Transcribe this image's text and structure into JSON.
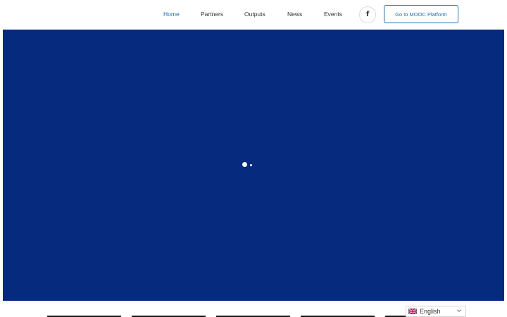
{
  "header": {
    "nav": [
      {
        "label": "Home",
        "active": true
      },
      {
        "label": "Partners",
        "active": false
      },
      {
        "label": "Outputs",
        "active": false
      },
      {
        "label": "News",
        "active": false
      },
      {
        "label": "Events",
        "active": false
      }
    ],
    "social": {
      "label": "f",
      "icon": "facebook-icon"
    },
    "cta_label": "Go to MOOC Platform"
  },
  "hero": {
    "background_color": "#062a7e",
    "slider_dots": 2
  },
  "language_selector": {
    "selected": "English",
    "icon": "uk-flag-icon"
  },
  "colors": {
    "accent": "#1e6fb5",
    "hero": "#062a7e"
  }
}
